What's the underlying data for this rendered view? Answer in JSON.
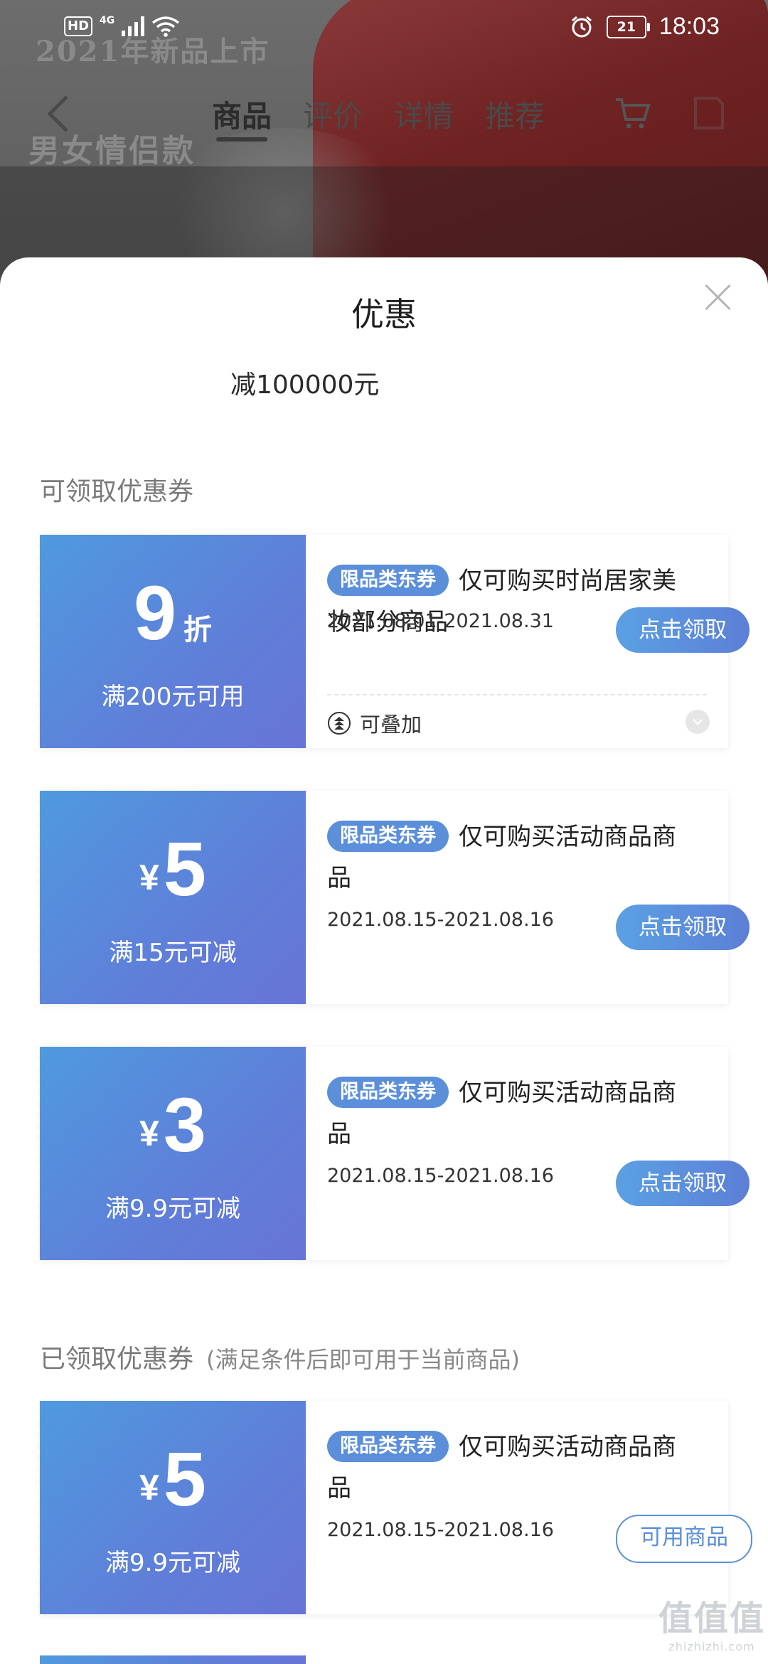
{
  "status_bar": {
    "hd": "HD",
    "network": "4G",
    "battery": "21",
    "time": "18:03"
  },
  "background": {
    "ad_line1": "2021年新品上市",
    "ad_line2": "男女情侣款"
  },
  "nav": {
    "tabs": [
      "商品",
      "评价",
      "详情",
      "推荐"
    ],
    "active_tab": "商品"
  },
  "sheet": {
    "title": "优惠",
    "promo": "减100000元"
  },
  "available_section": {
    "title": "可领取优惠券"
  },
  "claimed_section": {
    "title": "已领取优惠券",
    "subtitle": "(满足条件后即可用于当前商品)"
  },
  "coupons": [
    {
      "value": "9",
      "unit": "折",
      "condition": "满200元可用",
      "tag": "限品类东券",
      "description": "仅可购买时尚居家美妆部分商品",
      "dates": "2021.08.01-2021.08.31",
      "button": "点击领取",
      "stack_label": "可叠加"
    },
    {
      "currency": "¥",
      "value": "5",
      "condition": "满15元可减",
      "tag": "限品类东券",
      "description": "仅可购买活动商品商品",
      "dates": "2021.08.15-2021.08.16",
      "button": "点击领取"
    },
    {
      "currency": "¥",
      "value": "3",
      "condition": "满9.9元可减",
      "tag": "限品类东券",
      "description": "仅可购买活动商品商品",
      "dates": "2021.08.15-2021.08.16",
      "button": "点击领取"
    },
    {
      "currency": "¥",
      "value": "5",
      "condition": "满9.9元可减",
      "tag": "限品类东券",
      "description": "仅可购买活动商品商品",
      "dates": "2021.08.15-2021.08.16",
      "button": "可用商品"
    }
  ],
  "watermark": {
    "logo": "值值值",
    "url": "zhizhizhi.com"
  },
  "colors": {
    "coupon_gradient_start": "#4f9ade",
    "coupon_gradient_end": "#6774d6",
    "accent_blue": "#5b8fd9"
  }
}
